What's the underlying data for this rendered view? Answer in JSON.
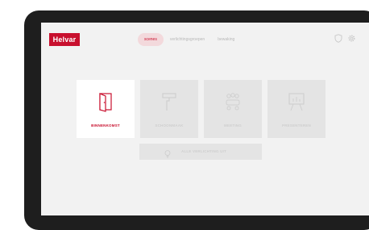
{
  "brand": {
    "logo_text": "Helvar",
    "accent_color": "#c8102e"
  },
  "nav": {
    "tabs": [
      {
        "label": "scenes",
        "active": true
      },
      {
        "label": "verlichtingsgroepen",
        "active": false
      },
      {
        "label": "bewaking",
        "active": false
      }
    ],
    "icons": [
      "shield-icon",
      "gear-icon"
    ]
  },
  "scenes": [
    {
      "label": "BINNENKOMST",
      "icon": "door-icon",
      "active": true
    },
    {
      "label": "SCHOONMAAK",
      "icon": "paint-roller-icon",
      "active": false
    },
    {
      "label": "MEETING",
      "icon": "meeting-icon",
      "active": false
    },
    {
      "label": "PRESENTEREN",
      "icon": "presentation-board-icon",
      "active": false
    }
  ],
  "all_lights_button": {
    "label": "ALLE VERLICHTING UIT",
    "icon": "lightbulb-icon"
  }
}
